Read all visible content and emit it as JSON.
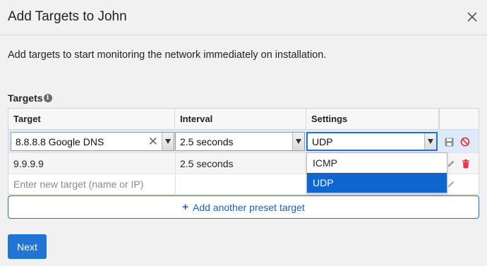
{
  "dialog": {
    "title": "Add Targets to John",
    "intro": "Add targets to start monitoring the network immediately on installation."
  },
  "section": {
    "label": "Targets"
  },
  "table": {
    "columns": [
      "Target",
      "Interval",
      "Settings"
    ],
    "edit_row": {
      "target": "8.8.8.8 Google DNS",
      "interval": "2.5 seconds",
      "settings": "UDP"
    },
    "data_row": {
      "target": "9.9.9.9",
      "interval": "2.5 seconds"
    },
    "new_row": {
      "placeholder": "Enter new target (name or IP)"
    }
  },
  "settings_dropdown": {
    "options": [
      "ICMP",
      "UDP"
    ],
    "selected": "UDP"
  },
  "add_preset": {
    "label": "Add another preset target"
  },
  "footer": {
    "next_label": "Next"
  },
  "colors": {
    "accent": "#1f74d4",
    "edit_row_bg": "#ddeaf7",
    "delete_icon": "#e0394a",
    "cancel_icon": "#e0394a"
  }
}
